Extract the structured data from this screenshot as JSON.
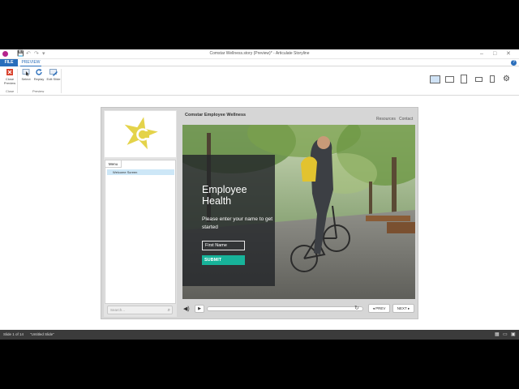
{
  "window": {
    "title": "Comstar Wellness.story (Preview)* - Articulate Storyline",
    "minimize": "–",
    "maximize": "□",
    "close": "✕"
  },
  "quick_access": {
    "save_icon": "💾",
    "undo_icon": "↶",
    "redo_icon": "↷",
    "dropdown_icon": "▾"
  },
  "ribbon": {
    "tabs": {
      "file": "FILE",
      "preview": "PREVIEW"
    },
    "help_icon": "?",
    "buttons": {
      "close_preview": "Close Preview",
      "select": "Select",
      "replay": "Replay",
      "edit_slide": "Edit Slide"
    },
    "groups": {
      "close": "Close",
      "preview": "Preview"
    },
    "device_views": [
      "desktop",
      "tablet-landscape",
      "tablet-portrait",
      "phone-landscape",
      "phone-portrait"
    ],
    "settings_icon": "⚙"
  },
  "player": {
    "course_title": "Comstar Employee Wellness",
    "links": {
      "resources": "Resources",
      "contact": "Contact"
    },
    "sidebar": {
      "menu_tab": "Menu",
      "menu_items": [
        "Welcome Screen"
      ],
      "search_placeholder": "Search...",
      "search_icon": "⌕"
    },
    "controls": {
      "volume_icon": "◀)",
      "play_icon": "▶",
      "replay_icon": "↻",
      "prev": "◂ PREV",
      "next": "NEXT ▸"
    }
  },
  "slide": {
    "heading": "Employee Health",
    "prompt": "Please enter your name to get started",
    "name_placeholder": "First Name",
    "submit_label": "SUBMIT"
  },
  "status": {
    "slide_info": "Slide 1 of 14",
    "slide_name": "\"Untitled Slide\""
  },
  "colors": {
    "accent_blue": "#2a6ebb",
    "submit_teal": "#17b39a",
    "logo_yellow": "#e4d34a",
    "menu_highlight": "#cde7f7"
  }
}
